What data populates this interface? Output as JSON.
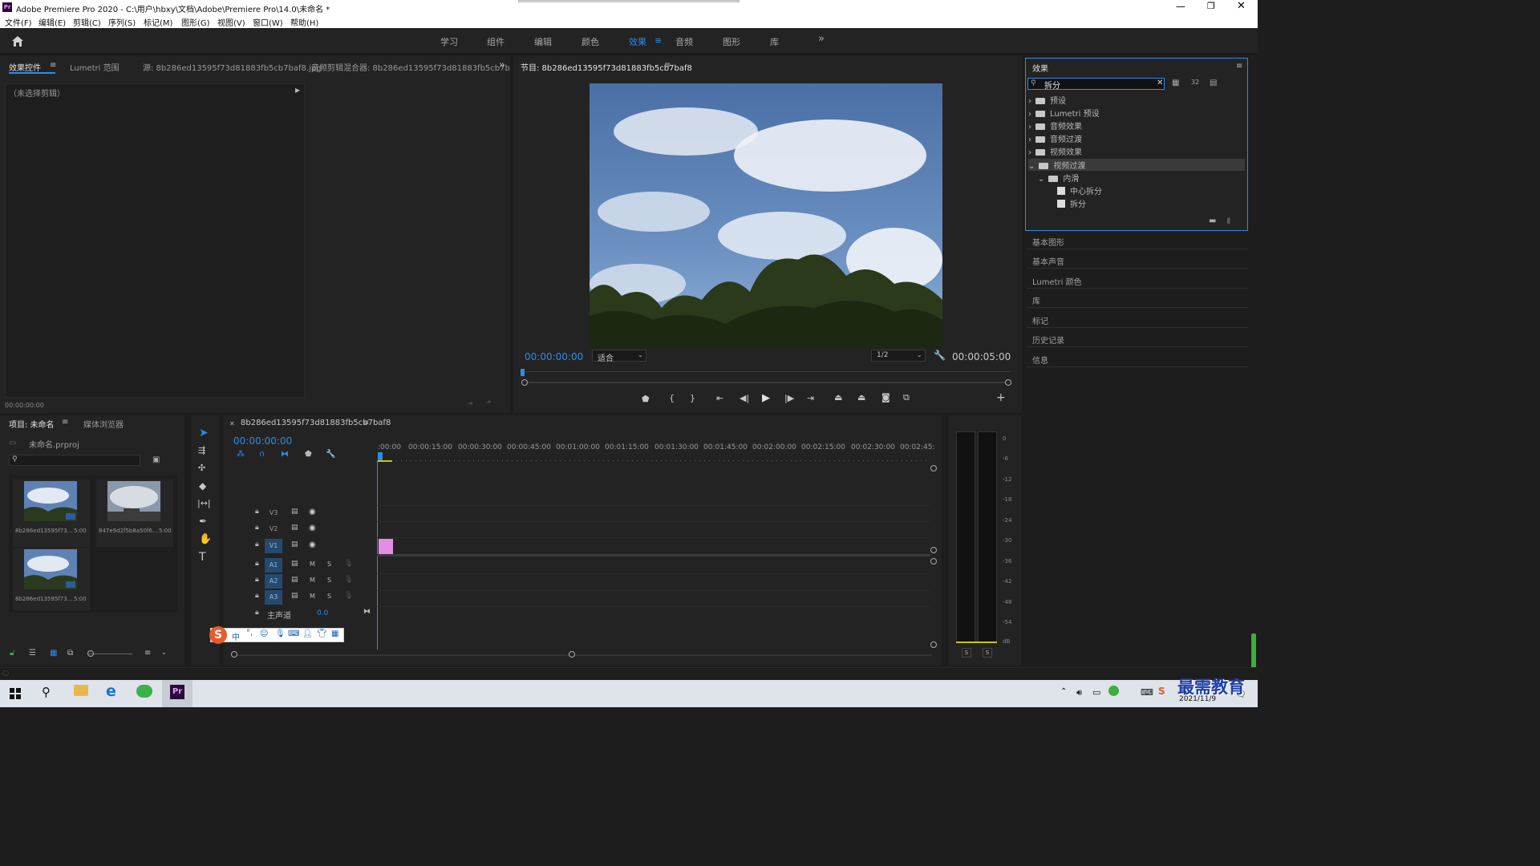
{
  "window": {
    "title": "Adobe Premiere Pro 2020 - C:\\用户\\hbxy\\文档\\Adobe\\Premiere Pro\\14.0\\未命名 *",
    "app_icon": "Pr"
  },
  "menu": [
    "文件(F)",
    "编辑(E)",
    "剪辑(C)",
    "序列(S)",
    "标记(M)",
    "图形(G)",
    "视图(V)",
    "窗口(W)",
    "帮助(H)"
  ],
  "workspaces": [
    "学习",
    "组件",
    "编辑",
    "颜色",
    "效果",
    "音频",
    "图形",
    "库"
  ],
  "workspace_active": "效果",
  "source_panel": {
    "tabs": [
      "效果控件",
      "Lumetri 范围",
      "源: 8b286ed13595f73d81883fb5cb7baf8.jpg",
      "音频剪辑混合器: 8b286ed13595f73d81883fb5cb7b"
    ],
    "no_clip": "（未选择剪辑）",
    "timecode": "00:00:00:00"
  },
  "program": {
    "title": "节目: 8b286ed13595f73d81883fb5cb7baf8",
    "timecode": "00:00:00:00",
    "fit": "适合",
    "quality": "1/2",
    "duration": "00:00:05:00"
  },
  "effects": {
    "title": "效果",
    "search_value": "拆分",
    "tree": [
      {
        "label": "预设",
        "level": 0,
        "type": "folder-star"
      },
      {
        "label": "Lumetri 预设",
        "level": 0,
        "type": "folder-star"
      },
      {
        "label": "音频效果",
        "level": 0,
        "type": "folder"
      },
      {
        "label": "音频过渡",
        "level": 0,
        "type": "folder"
      },
      {
        "label": "视频效果",
        "level": 0,
        "type": "folder"
      },
      {
        "label": "视频过渡",
        "level": 0,
        "type": "folder",
        "expanded": true,
        "selected": true
      },
      {
        "label": "内滑",
        "level": 1,
        "type": "folder",
        "expanded": true
      },
      {
        "label": "中心拆分",
        "level": 2,
        "type": "effect"
      },
      {
        "label": "拆分",
        "level": 2,
        "type": "effect"
      }
    ]
  },
  "side_panels": [
    "基本图形",
    "基本声音",
    "Lumetri 颜色",
    "库",
    "标记",
    "历史记录",
    "信息"
  ],
  "project": {
    "tabs": [
      "项目: 未命名",
      "媒体浏览器"
    ],
    "file": "未命名.prproj",
    "items": [
      {
        "name": "8b286ed13595f73...",
        "duration": "5:00"
      },
      {
        "name": "847e9d2f5b8a50f6...",
        "duration": "5:00"
      },
      {
        "name": "8b286ed13595f73...",
        "duration": "5:00"
      }
    ]
  },
  "timeline": {
    "sequence_name": "8b286ed13595f73d81883fb5cb7baf8",
    "timecode": "00:00:00:00",
    "ruler": [
      ":00:00",
      "00:00:15:00",
      "00:00:30:00",
      "00:00:45:00",
      "00:01:00:00",
      "00:01:15:00",
      "00:01:30:00",
      "00:01:45:00",
      "00:02:00:00",
      "00:02:15:00",
      "00:02:30:00",
      "00:02:45:"
    ],
    "video_tracks": [
      "V3",
      "V2",
      "V1"
    ],
    "audio_tracks": [
      "A1",
      "A2",
      "A3"
    ],
    "master": {
      "label": "主声道",
      "value": "0.0"
    },
    "m_label": "M",
    "s_label": "S"
  },
  "meter": {
    "scale": [
      "0",
      "-6",
      "-12",
      "-18",
      "-24",
      "-30",
      "-36",
      "-42",
      "-48",
      "-54",
      "dB"
    ],
    "solo": [
      "S",
      "S"
    ]
  },
  "tools": [
    "selection-tool",
    "track-select-tool",
    "ripple-edit-tool",
    "razor-tool",
    "slip-tool",
    "pen-tool",
    "hand-tool",
    "type-tool"
  ],
  "ime": {
    "lang": "中"
  },
  "taskbar": {
    "date": "2021/11/9"
  },
  "watermark": "最需教育",
  "colors": {
    "accent": "#2d8ceb",
    "clip": "#e28ee4",
    "panel": "#232323",
    "bg": "#1d1d1d"
  }
}
